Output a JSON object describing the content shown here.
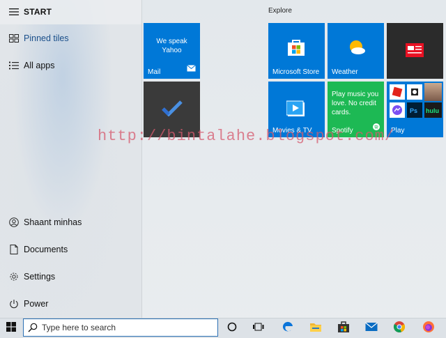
{
  "start": {
    "header": "START",
    "items": [
      {
        "label": "Pinned tiles",
        "icon": "pinned-tiles-icon"
      },
      {
        "label": "All apps",
        "icon": "all-apps-icon"
      }
    ],
    "bottom_items": [
      {
        "label": "Shaant minhas",
        "icon": "user-icon"
      },
      {
        "label": "Documents",
        "icon": "document-icon"
      },
      {
        "label": "Settings",
        "icon": "gear-icon"
      },
      {
        "label": "Power",
        "icon": "power-icon"
      }
    ]
  },
  "explore": {
    "title": "Explore"
  },
  "tiles": {
    "mail": {
      "body": "We speak Yahoo",
      "label": "Mail"
    },
    "todo": {
      "label": ""
    },
    "store": {
      "label": "Microsoft Store"
    },
    "weather": {
      "label": "Weather"
    },
    "news": {
      "label": ""
    },
    "movies": {
      "label": "Movies & TV"
    },
    "spotify": {
      "body": "Play music you love. No credit cards.",
      "label": "Spotify"
    },
    "play": {
      "label": "Play"
    }
  },
  "watermark": "http://bintalahe.blogspot.com/",
  "taskbar": {
    "search_placeholder": "Type here to search",
    "icons": [
      "windows-icon",
      "cortana-icon",
      "task-view-icon",
      "edge-icon",
      "file-explorer-icon",
      "store-icon",
      "mail-icon",
      "chrome-icon",
      "firefox-icon"
    ]
  },
  "colors": {
    "tile_blue": "#0078d7",
    "tile_dark": "#3a3a3a",
    "tile_green": "#1db954",
    "accent": "#2a6fb3"
  }
}
